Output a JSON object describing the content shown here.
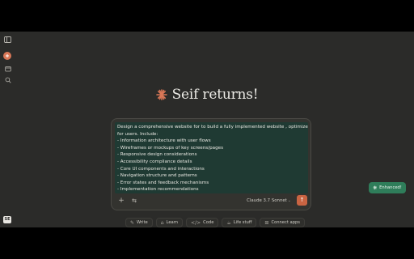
{
  "greeting": {
    "title": "Seif returns!"
  },
  "sidebar": {
    "user_initials": "SE"
  },
  "composer": {
    "prompt_lines": [
      "Design a comprehensive website for to build a fully implemented website , optimized",
      "for users. Include:",
      "- Information architecture with user flows",
      "- Wireframes or mockups of key screens/pages",
      "- Responsive design considerations",
      "- Accessibility compliance details",
      "- Core UI components and interactions",
      "- Navigation structure and patterns",
      "- Error states and feedback mechanisms",
      "- Implementation recommendations"
    ],
    "model_label": "Claude 3.7 Sonnet",
    "send_icon": "arrow-up-icon"
  },
  "chips": [
    {
      "label": "Write",
      "icon": "pencil-icon"
    },
    {
      "label": "Learn",
      "icon": "graduation-cap-icon"
    },
    {
      "label": "Code",
      "icon": "code-icon"
    },
    {
      "label": "Life stuff",
      "icon": "coffee-icon"
    },
    {
      "label": "Connect apps",
      "icon": "grid-icon"
    }
  ],
  "enhance": {
    "label": "Enhanced!"
  },
  "colors": {
    "accent": "#c96442",
    "enhance": "#2f7d5a",
    "prompt_bg": "#1f3a33",
    "app_bg": "#2b2b29"
  }
}
